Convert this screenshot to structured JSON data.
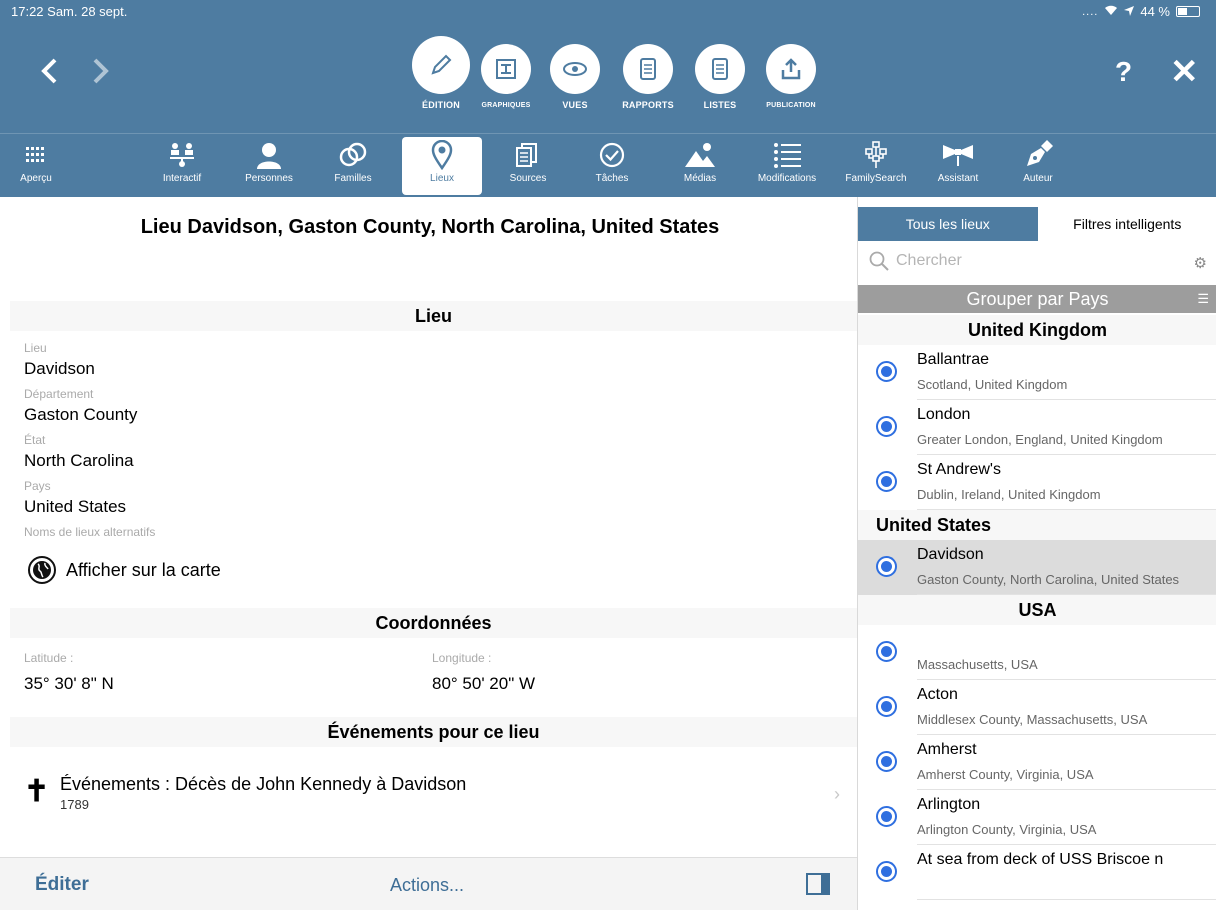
{
  "status": {
    "time": "17:22  Sam. 28 sept.",
    "battery": "44 %",
    "battery_level": 0.44
  },
  "toolbar": {
    "modes": [
      {
        "label": "ÉDITION",
        "icon": "pencil-icon"
      },
      {
        "label": "GRAPHIQUES",
        "icon": "chart-icon"
      },
      {
        "label": "VUES",
        "icon": "eye-icon"
      },
      {
        "label": "RAPPORTS",
        "icon": "document-icon"
      },
      {
        "label": "LISTES",
        "icon": "list-document-icon"
      },
      {
        "label": "PUBLICATION",
        "icon": "upload-icon"
      }
    ],
    "help": "?",
    "close": "✕"
  },
  "tabs": [
    {
      "label": "Aperçu",
      "icon": "grid-icon"
    },
    {
      "label": "Interactif",
      "icon": "tree-icon"
    },
    {
      "label": "Personnes",
      "icon": "person-icon"
    },
    {
      "label": "Familles",
      "icon": "rings-icon"
    },
    {
      "label": "Lieux",
      "icon": "location-pin-icon"
    },
    {
      "label": "Sources",
      "icon": "sources-icon"
    },
    {
      "label": "Tâches",
      "icon": "checkmark-icon"
    },
    {
      "label": "Médias",
      "icon": "media-icon"
    },
    {
      "label": "Modifications",
      "icon": "list-icon"
    },
    {
      "label": "FamilySearch",
      "icon": "familysearch-icon"
    },
    {
      "label": "Assistant",
      "icon": "bowtie-icon"
    },
    {
      "label": "Auteur",
      "icon": "pen-icon"
    }
  ],
  "detail": {
    "title": "Lieu Davidson, Gaston County, North Carolina, United States",
    "section_place": "Lieu",
    "fields": [
      {
        "label": "Lieu",
        "value": "Davidson"
      },
      {
        "label": "Département",
        "value": "Gaston County"
      },
      {
        "label": "État",
        "value": "North Carolina"
      },
      {
        "label": "Pays",
        "value": "United States"
      }
    ],
    "alt_names_label": "Noms de lieux alternatifs",
    "map_link": "Afficher sur la carte",
    "section_coords": "Coordonnées",
    "latitude_label": "Latitude :",
    "latitude_value": "35° 30' 8\" N",
    "longitude_label": "Longitude :",
    "longitude_value": "80° 50' 20\" W",
    "section_events": "Événements pour ce lieu",
    "event_title": "Événements : Décès de John Kennedy à Davidson",
    "event_year": "1789"
  },
  "bottom": {
    "edit": "Éditer",
    "actions": "Actions..."
  },
  "side": {
    "seg_all": "Tous les lieux",
    "seg_smart": "Filtres intelligents",
    "search_placeholder": "Chercher",
    "group_by": "Grouper par Pays",
    "groups": [
      {
        "name": "United Kingdom",
        "places": [
          {
            "name": "Ballantrae",
            "sub": "Scotland, United Kingdom"
          },
          {
            "name": "London",
            "sub": "Greater London, England, United Kingdom"
          },
          {
            "name": "St Andrew's",
            "sub": "Dublin, Ireland, United Kingdom"
          }
        ]
      },
      {
        "name": "United States",
        "places": [
          {
            "name": "Davidson",
            "sub": "Gaston County, North Carolina, United States",
            "selected": true
          }
        ]
      },
      {
        "name": "USA",
        "places": [
          {
            "name": "",
            "sub": "Massachusetts, USA"
          },
          {
            "name": "Acton",
            "sub": "Middlesex County, Massachusetts, USA"
          },
          {
            "name": "Amherst",
            "sub": "Amherst County, Virginia, USA"
          },
          {
            "name": "Arlington",
            "sub": "Arlington County, Virginia, USA"
          },
          {
            "name": "At sea from deck of USS Briscoe n",
            "sub": ""
          }
        ]
      }
    ]
  }
}
